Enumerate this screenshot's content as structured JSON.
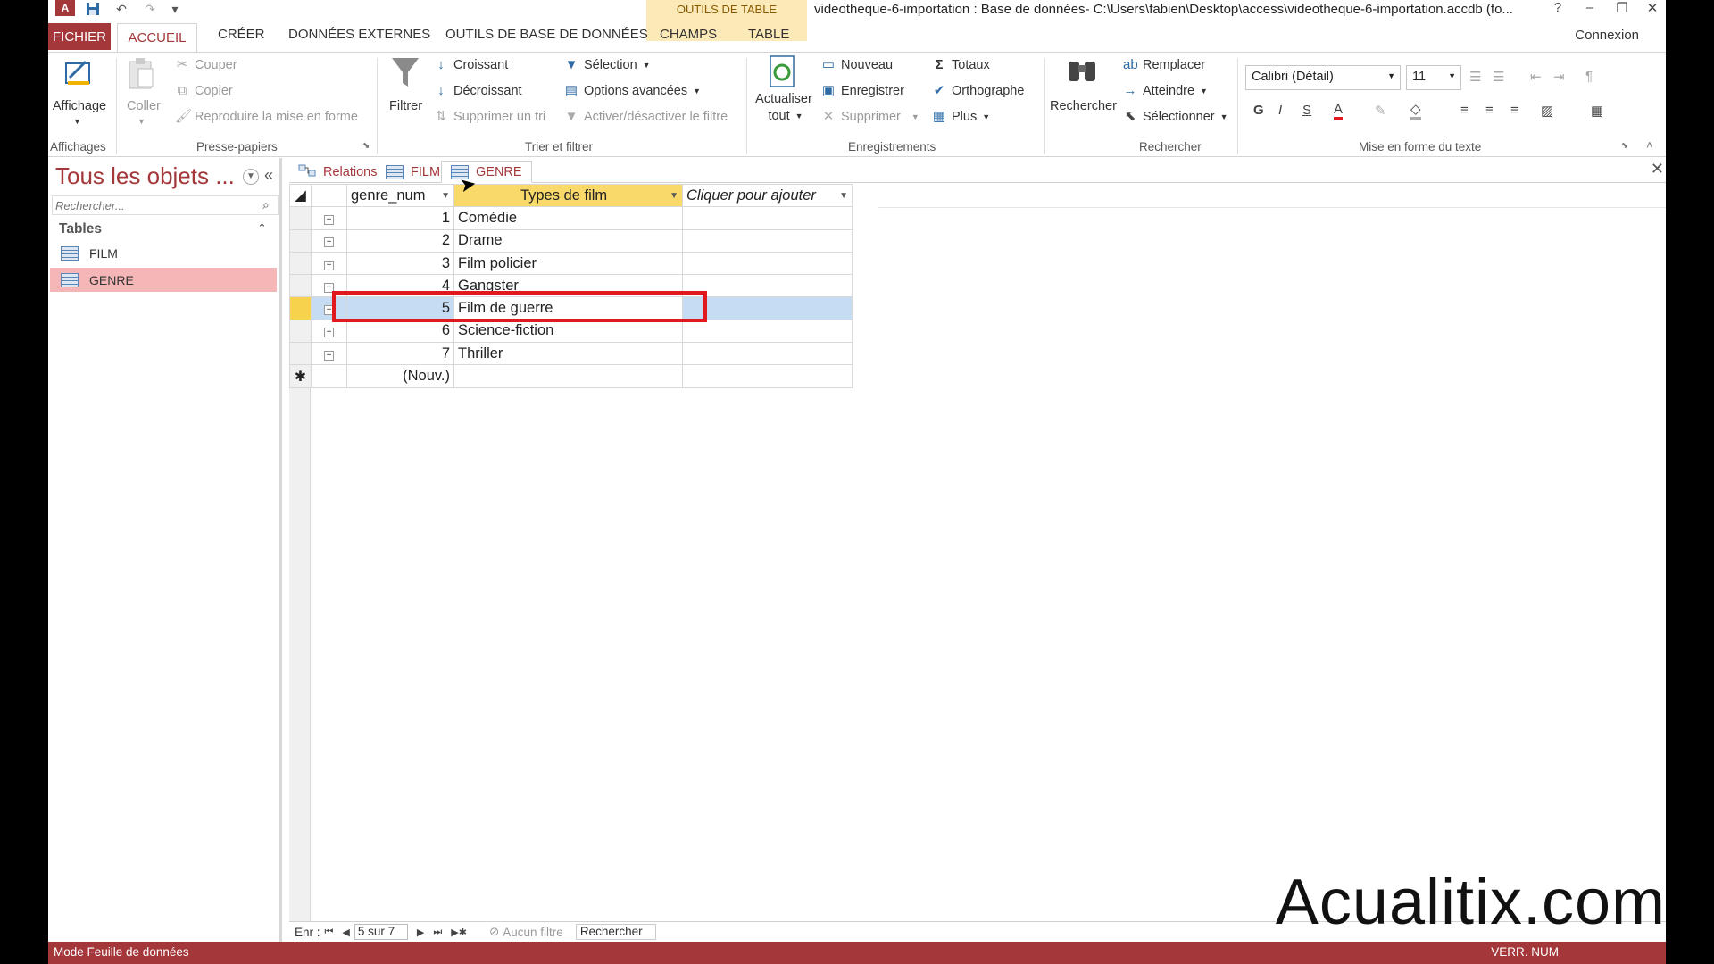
{
  "window": {
    "title": "videotheque-6-importation : Base de données- C:\\Users\\fabien\\Desktop\\access\\videotheque-6-importation.accdb (fo...",
    "context_tools": "OUTILS DE TABLE",
    "controls": {
      "help": "?",
      "minimize": "–",
      "restore": "❐",
      "close": "✕"
    }
  },
  "quick_access": {
    "app_icon": "A",
    "save": "💾",
    "undo": "↶",
    "redo": "↷",
    "more": "▾"
  },
  "ribbon_tabs": [
    "FICHIER",
    "ACCUEIL",
    "CRÉER",
    "DONNÉES EXTERNES",
    "OUTILS DE BASE DE DONNÉES",
    "CHAMPS",
    "TABLE"
  ],
  "connexion": "Connexion",
  "ribbon": {
    "affichages": {
      "button": "Affichage",
      "group": "Affichages"
    },
    "presse_papiers": {
      "coller": "Coller",
      "couper": "Couper",
      "copier": "Copier",
      "reproduire": "Reproduire la mise en forme",
      "group": "Presse-papiers"
    },
    "trier_filtrer": {
      "filtrer": "Filtrer",
      "croissant": "Croissant",
      "decroissant": "Décroissant",
      "supprimer_tri": "Supprimer un tri",
      "selection": "Sélection",
      "options_avancees": "Options avancées",
      "activer_filtre": "Activer/désactiver le filtre",
      "group": "Trier et filtrer"
    },
    "enregistrements": {
      "actualiser": "Actualiser",
      "actualiser2": "tout",
      "nouveau": "Nouveau",
      "enregistrer": "Enregistrer",
      "supprimer": "Supprimer",
      "totaux": "Totaux",
      "orthographe": "Orthographe",
      "plus": "Plus",
      "group": "Enregistrements"
    },
    "rechercher": {
      "rechercher": "Rechercher",
      "remplacer": "Remplacer",
      "atteindre": "Atteindre",
      "selectionner": "Sélectionner",
      "group": "Rechercher"
    },
    "texte": {
      "font": "Calibri (Détail)",
      "size": "11",
      "bold": "G",
      "italic": "I",
      "underline": "S",
      "group": "Mise en forme du texte"
    }
  },
  "nav": {
    "title": "Tous les objets ...",
    "search_placeholder": "Rechercher...",
    "section": "Tables",
    "items": [
      {
        "label": "FILM",
        "selected": false
      },
      {
        "label": "GENRE",
        "selected": true
      }
    ]
  },
  "doc_tabs": [
    {
      "label": "Relations",
      "icon": "relations-icon",
      "active": false
    },
    {
      "label": "FILM",
      "icon": "table-icon",
      "active": false
    },
    {
      "label": "GENRE",
      "icon": "table-icon",
      "active": true
    }
  ],
  "sheet": {
    "headers": {
      "num": "genre_num",
      "type": "Types de film",
      "add": "Cliquer pour ajouter"
    },
    "rows": [
      {
        "num": "1",
        "type": "Comédie"
      },
      {
        "num": "2",
        "type": "Drame"
      },
      {
        "num": "3",
        "type": "Film policier"
      },
      {
        "num": "4",
        "type": "Gangster"
      },
      {
        "num": "5",
        "type": "Film de guerre",
        "selected": true
      },
      {
        "num": "6",
        "type": "Science-fiction"
      },
      {
        "num": "7",
        "type": "Thriller"
      }
    ],
    "new_row": "(Nouv.)"
  },
  "record_nav": {
    "label": "Enr :",
    "position": "5 sur 7",
    "filter": "Aucun filtre",
    "search": "Rechercher"
  },
  "status": {
    "left": "Mode Feuille de données",
    "right": "VERR. NUM"
  },
  "watermark": "Acualitix.com"
}
